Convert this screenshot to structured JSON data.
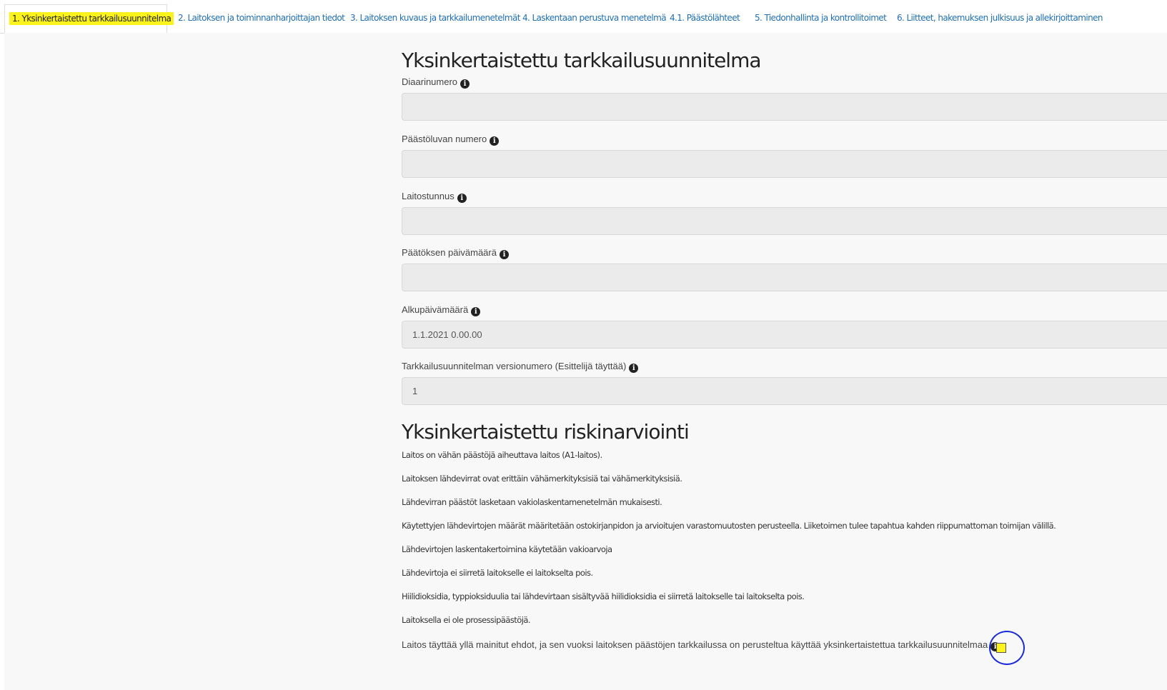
{
  "tabs": [
    {
      "label": "1. Yksinkertaistettu tarkkailusuunnitelma",
      "active": true
    },
    {
      "label": "2. Laitoksen ja toiminnanharjoittajan tiedot"
    },
    {
      "label": "3. Laitoksen kuvaus ja tarkkailumenetelmät"
    },
    {
      "label": "4. Laskentaan perustuva menetelmä"
    },
    {
      "label": "4.1. Päästölähteet"
    },
    {
      "label": "5. Tiedonhallinta ja kontrollitoimet"
    },
    {
      "label": "6. Liitteet, hakemuksen julkisuus ja allekirjoittaminen"
    }
  ],
  "main": {
    "title": "Yksinkertaistettu tarkkailusuunnitelma",
    "fields": [
      {
        "label": "Diaarinumero",
        "value": ""
      },
      {
        "label": "Päästöluvan numero",
        "value": ""
      },
      {
        "label": "Laitostunnus",
        "value": ""
      },
      {
        "label": "Päätöksen päivämäärä",
        "value": ""
      },
      {
        "label": "Alkupäivämäärä",
        "value": "1.1.2021 0.00.00"
      },
      {
        "label": "Tarkkailusuunnitelman versionumero (Esittelijä täyttää)",
        "value": "1"
      }
    ],
    "risk_title": "Yksinkertaistettu riskinarviointi",
    "risk_lines": [
      "Laitos on vähän päästöjä aiheuttava laitos (A1-laitos).",
      "Laitoksen lähdevirrat ovat erittäin vähämerkityksisiä tai vähämerkityksisiä.",
      "Lähdevirran päästöt lasketaan vakiolaskentamenetelmän mukaisesti.",
      "Käytettyjen lähdevirtojen määrät määritetään ostokirjanpidon ja arvioitujen varastomuutosten perusteella. Liiketoimen tulee tapahtua kahden riippumattoman toimijan välillä.",
      "Lähdevirtojen laskentakertoimina käytetään vakioarvoja",
      "Lähdevirtoja ei siirretä laitokselle ei laitokselta pois.",
      "Hiilidioksidia, typpioksiduulia tai lähdevirtaan sisältyvää hiilidioksidia ei siirretä laitokselle tai laitokselta pois.",
      "Laitoksella ei ole prosessipäästöjä."
    ],
    "confirm_text": "Laitos täyttää yllä mainitut ehdot, ja sen vuoksi laitoksen päästöjen tarkkailussa on perusteltua käyttää yksinkertaistettua tarkkailusuunnitelmaa",
    "info_glyph": "i"
  },
  "colors": {
    "highlight": "#fbf31b",
    "link": "#1f6fb5",
    "annotation": "#1a2ad8"
  }
}
